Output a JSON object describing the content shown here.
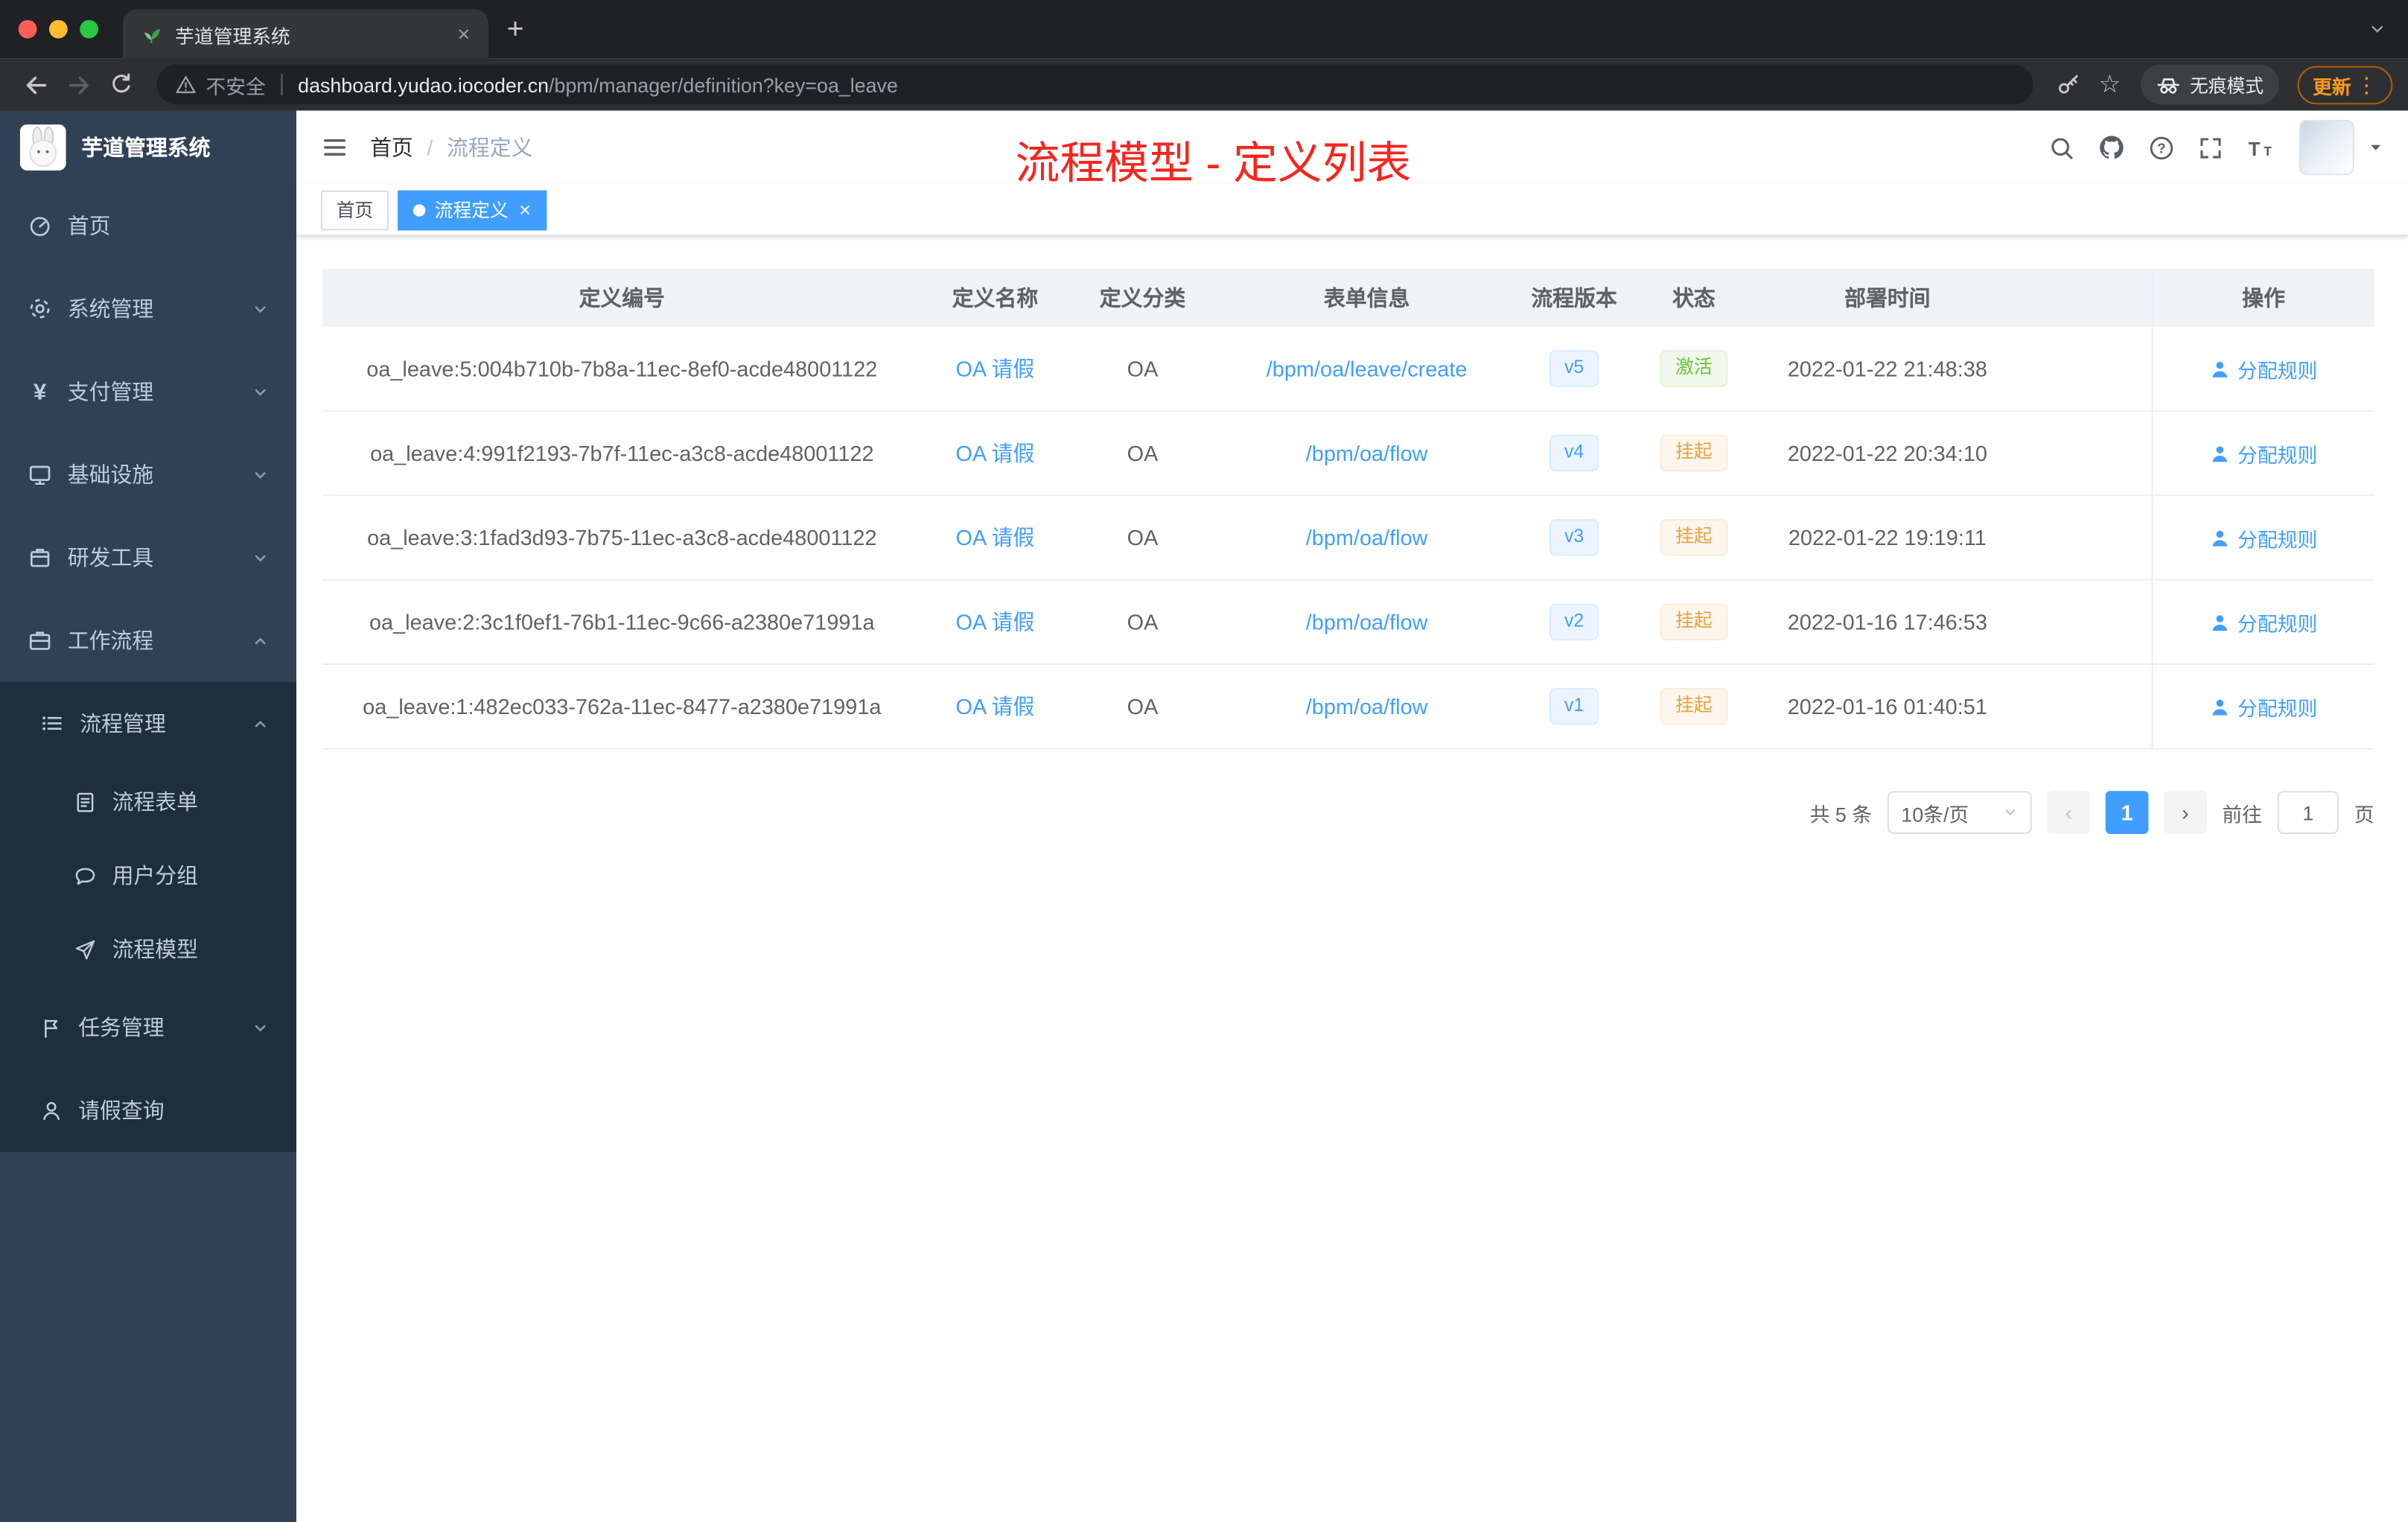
{
  "browser": {
    "tab": {
      "title": "芋道管理系统"
    },
    "toolbar": {
      "security_label": "不安全",
      "url_host": "dashboard.yudao.iocoder.cn",
      "url_path": "/bpm/manager/definition?key=oa_leave",
      "incognito_label": "无痕模式",
      "update_label": "更新"
    }
  },
  "sidebar": {
    "logo_title": "芋道管理系统",
    "menu": [
      {
        "label": "首页"
      },
      {
        "label": "系统管理"
      },
      {
        "label": "支付管理"
      },
      {
        "label": "基础设施"
      },
      {
        "label": "研发工具"
      },
      {
        "label": "工作流程"
      }
    ],
    "submenu": {
      "process_mgmt": "流程管理",
      "children": [
        {
          "label": "流程表单"
        },
        {
          "label": "用户分组"
        },
        {
          "label": "流程模型"
        }
      ],
      "task_mgmt": "任务管理",
      "leave_query": "请假查询"
    }
  },
  "navbar": {
    "breadcrumb": [
      "首页",
      "流程定义"
    ],
    "breadcrumb_separator": "/",
    "annotation": "流程模型 - 定义列表"
  },
  "tags": [
    {
      "label": "首页"
    },
    {
      "label": "流程定义"
    }
  ],
  "table": {
    "columns": [
      "定义编号",
      "定义名称",
      "定义分类",
      "表单信息",
      "流程版本",
      "状态",
      "部署时间",
      "操作"
    ],
    "rows": [
      {
        "id": "oa_leave:5:004b710b-7b8a-11ec-8ef0-acde48001122",
        "name": "OA 请假",
        "category": "OA",
        "form": "/bpm/oa/leave/create",
        "version": "v5",
        "status": "激活",
        "status_type": "success",
        "deploy_time": "2022-01-22 21:48:38",
        "action": "分配规则"
      },
      {
        "id": "oa_leave:4:991f2193-7b7f-11ec-a3c8-acde48001122",
        "name": "OA 请假",
        "category": "OA",
        "form": "/bpm/oa/flow",
        "version": "v4",
        "status": "挂起",
        "status_type": "warning",
        "deploy_time": "2022-01-22 20:34:10",
        "action": "分配规则"
      },
      {
        "id": "oa_leave:3:1fad3d93-7b75-11ec-a3c8-acde48001122",
        "name": "OA 请假",
        "category": "OA",
        "form": "/bpm/oa/flow",
        "version": "v3",
        "status": "挂起",
        "status_type": "warning",
        "deploy_time": "2022-01-22 19:19:11",
        "action": "分配规则"
      },
      {
        "id": "oa_leave:2:3c1f0ef1-76b1-11ec-9c66-a2380e71991a",
        "name": "OA 请假",
        "category": "OA",
        "form": "/bpm/oa/flow",
        "version": "v2",
        "status": "挂起",
        "status_type": "warning",
        "deploy_time": "2022-01-16 17:46:53",
        "action": "分配规则"
      },
      {
        "id": "oa_leave:1:482ec033-762a-11ec-8477-a2380e71991a",
        "name": "OA 请假",
        "category": "OA",
        "form": "/bpm/oa/flow",
        "version": "v1",
        "status": "挂起",
        "status_type": "warning",
        "deploy_time": "2022-01-16 01:40:51",
        "action": "分配规则"
      }
    ]
  },
  "pagination": {
    "total": "共 5 条",
    "page_size": "10条/页",
    "page": "1",
    "goto": "前往",
    "goto_value": "1",
    "unit": "页"
  },
  "colors": {
    "accent": "#409eff",
    "annotation_red": "#f5261d",
    "success": "#67c23a",
    "warning": "#e6a23c",
    "sidebar_bg": "#304156",
    "submenu_bg": "#1f2d3d"
  }
}
